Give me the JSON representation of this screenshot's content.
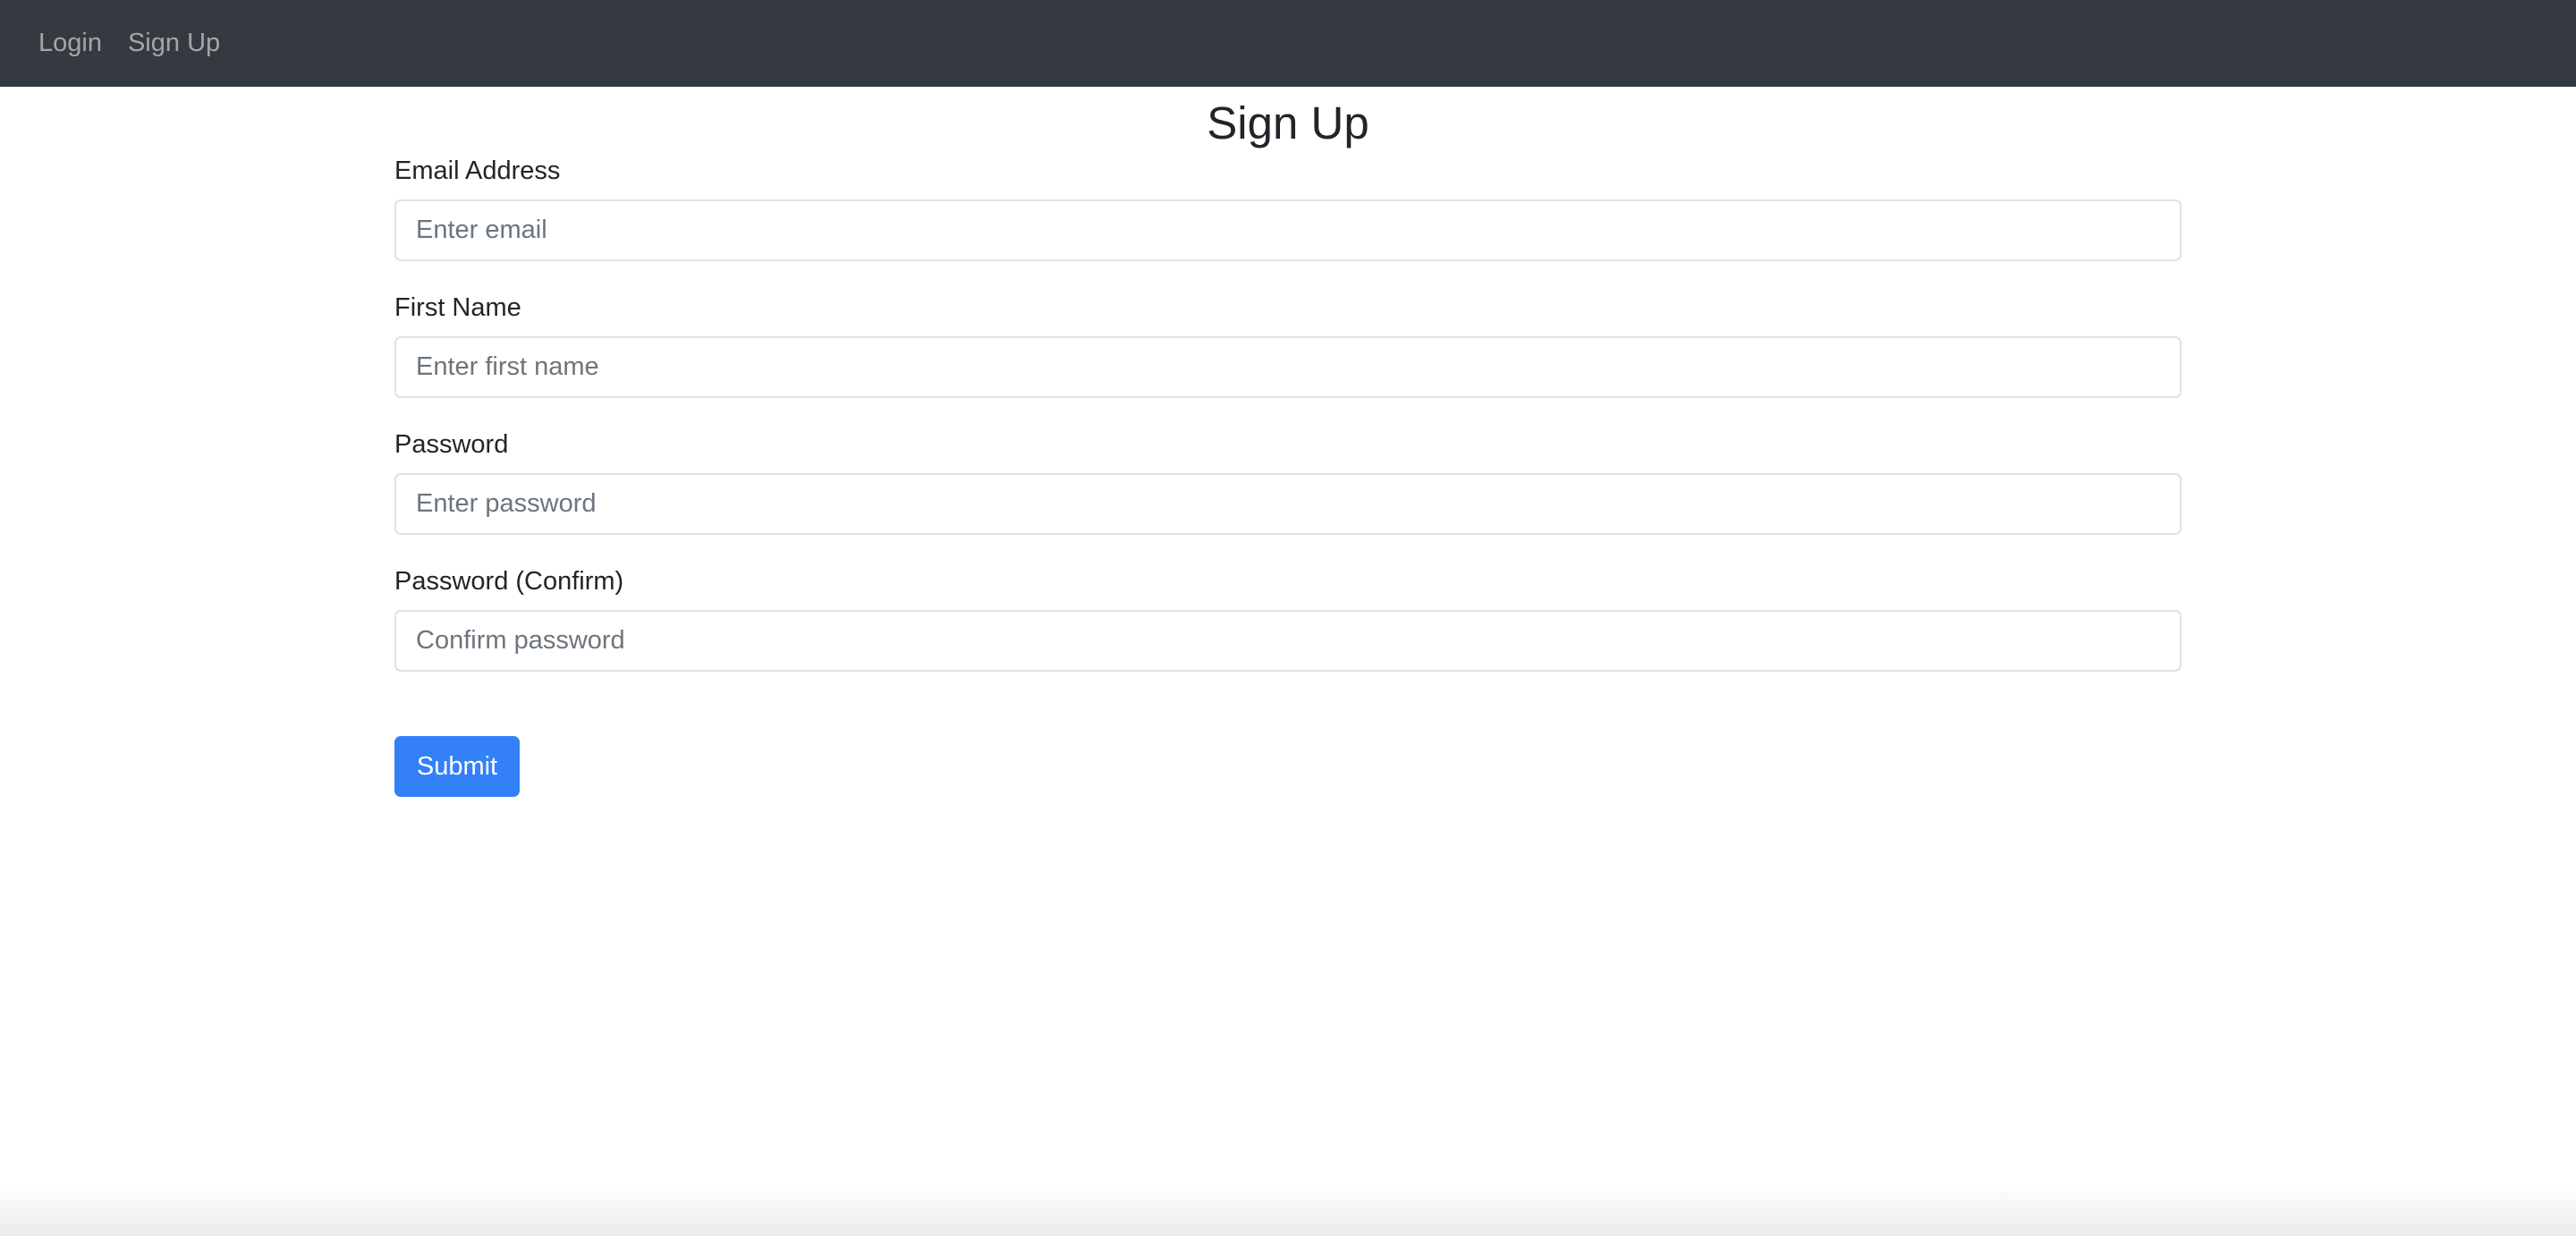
{
  "navbar": {
    "links": [
      {
        "label": "Login"
      },
      {
        "label": "Sign Up"
      }
    ]
  },
  "page": {
    "title": "Sign Up"
  },
  "form": {
    "fields": [
      {
        "label": "Email Address",
        "placeholder": "Enter email",
        "value": ""
      },
      {
        "label": "First Name",
        "placeholder": "Enter first name",
        "value": ""
      },
      {
        "label": "Password",
        "placeholder": "Enter password",
        "value": ""
      },
      {
        "label": "Password (Confirm)",
        "placeholder": "Confirm password",
        "value": ""
      }
    ],
    "submit_label": "Submit"
  },
  "colors": {
    "navbar_bg": "#343a40",
    "primary": "#3480f6",
    "input_border": "#dee2e6"
  }
}
